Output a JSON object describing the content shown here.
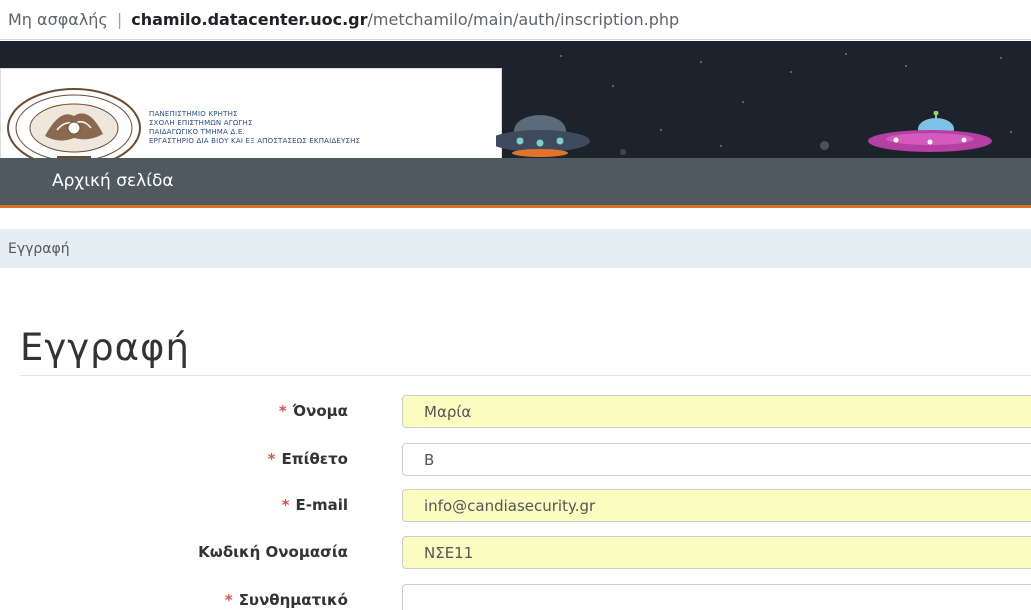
{
  "address_bar": {
    "security_label": "Μη ασφαλής",
    "separator": "|",
    "host": "chamilo.datacenter.uoc.gr",
    "path": "/metchamilo/main/auth/inscription.php"
  },
  "logo": {
    "line1": "ΠΑΝΕΠΙΣΤΗΜΙΟ ΚΡΗΤΗΣ",
    "line2": "ΣΧΟΛΗ ΕΠΙΣΤΗΜΩΝ ΑΓΩΓΗΣ",
    "line3": "ΠΑΙΔΑΓΩΓΙΚΟ ΤΜΗΜΑ Δ.Ε.",
    "line4": "ΕΡΓΑΣΤΗΡΙΟ ΔΙΑ ΒΙΟΥ ΚΑΙ ΕΞ ΑΠΟΣΤΑΣΕΩΣ ΕΚΠΑΙΔΕΥΣΗΣ"
  },
  "nav": {
    "home": "Αρχική σελίδα"
  },
  "breadcrumb": {
    "current": "Εγγραφή"
  },
  "page": {
    "title": "Εγγραφή"
  },
  "form": {
    "required_mark": "*",
    "fields": [
      {
        "label": "Όνομα",
        "value": "Μαρία",
        "required": true,
        "autofilled": true
      },
      {
        "label": "Επίθετο",
        "value": "Β",
        "required": true,
        "autofilled": false
      },
      {
        "label": "E-mail",
        "value": "info@candiasecurity.gr",
        "required": true,
        "autofilled": true
      },
      {
        "label": "Κωδική Ονομασία",
        "value": "ΝΣΕ11",
        "required": false,
        "autofilled": true
      },
      {
        "label": "Συνθηματικό",
        "value": "",
        "required": true,
        "autofilled": false
      }
    ]
  },
  "colors": {
    "banner_bg": "#1d232c",
    "nav_bg": "#4e5a60",
    "nav_accent": "#e06f1f",
    "breadcrumb_bg": "#e5eef2",
    "required": "#d9534f",
    "autofill_bg": "#fafcc0"
  }
}
